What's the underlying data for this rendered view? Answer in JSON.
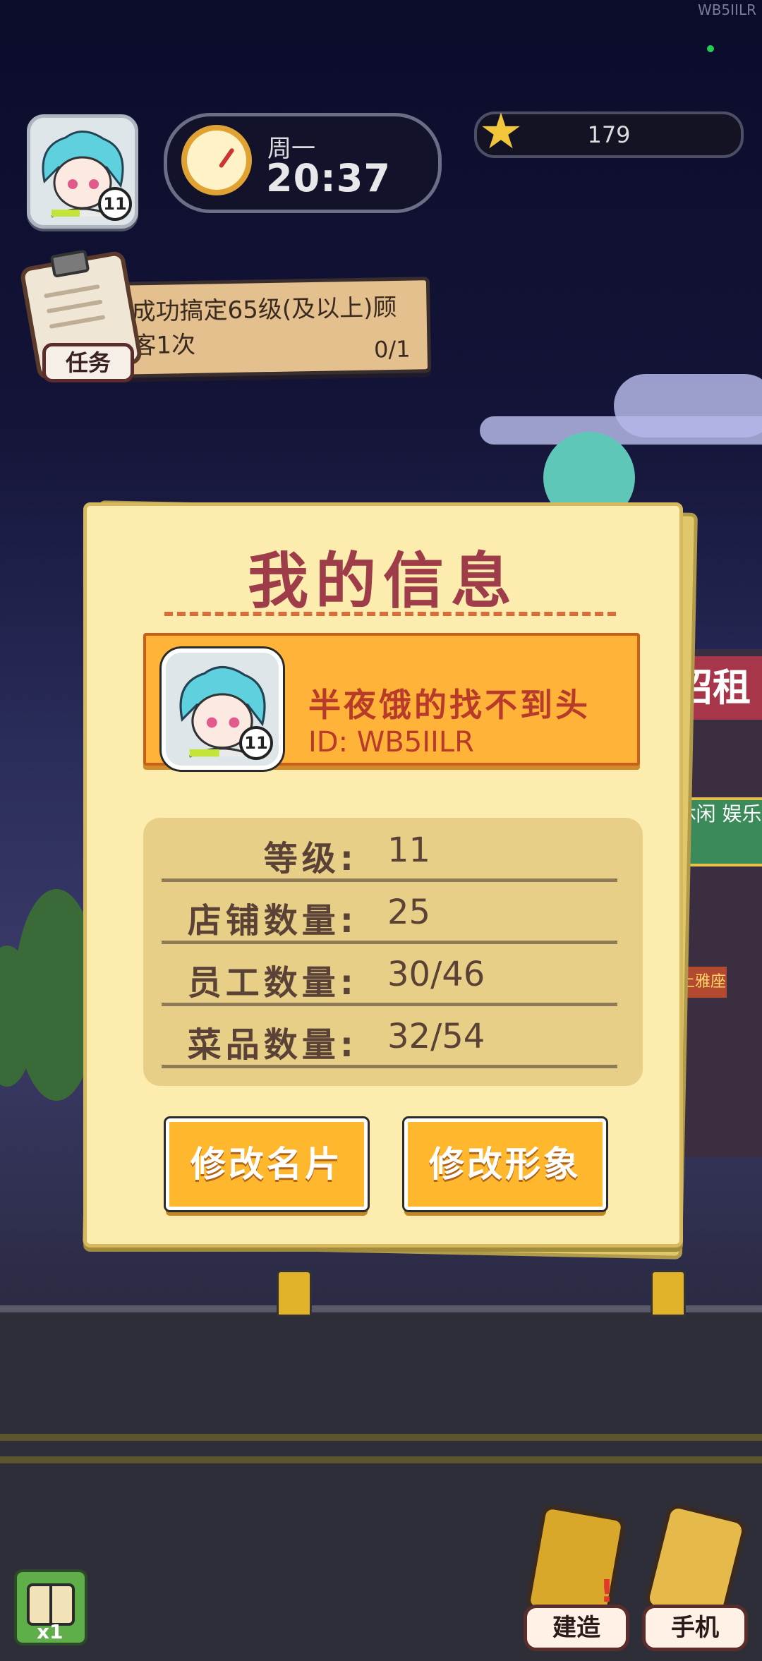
{
  "watermark": "WB5IILR",
  "player": {
    "level": "11"
  },
  "clock": {
    "weekday": "周一",
    "time": "20:37"
  },
  "stars": {
    "count": "179"
  },
  "task": {
    "label": "任务",
    "text": "成功搞定65级(及以上)顾客1次",
    "progress": "0/1"
  },
  "dialog": {
    "title": "我的信息",
    "name": "半夜饿的找不到头",
    "id": "ID: WB5IILR",
    "stats": [
      {
        "label": "等级:",
        "value": "11"
      },
      {
        "label": "店铺数量:",
        "value": "25"
      },
      {
        "label": "员工数量:",
        "value": "30/46"
      },
      {
        "label": "菜品数量:",
        "value": "32/54"
      }
    ],
    "buttons": {
      "edit_card": "修改名片",
      "edit_look": "修改形象"
    }
  },
  "scenery": {
    "sign1": "招租",
    "sign2": "休闲 娱乐",
    "sign3": "楼上雅座"
  },
  "bottom": {
    "book_mult": "x1",
    "build": "建造",
    "phone": "手机"
  },
  "icons": [
    "star-icon",
    "clock-icon",
    "clipboard-icon",
    "book-icon",
    "build-icon",
    "phone-icon"
  ]
}
